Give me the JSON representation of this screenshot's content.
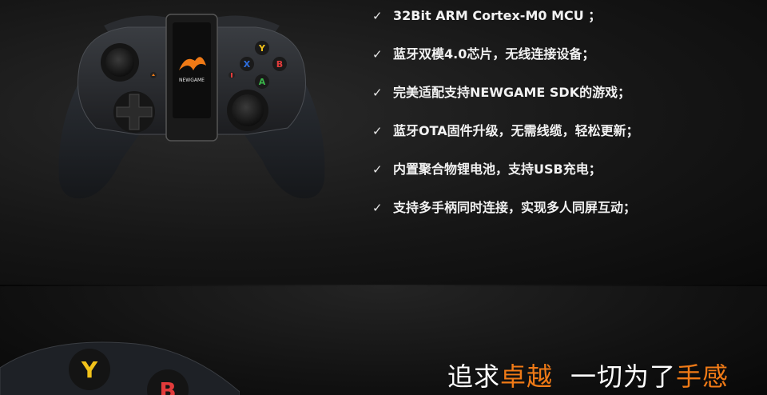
{
  "features": [
    {
      "check": "✓",
      "text": "32Bit ARM Cortex-M0 MCU ；"
    },
    {
      "check": "✓",
      "text": "蓝牙双模4.0芯片，无线连接设备；"
    },
    {
      "check": "✓",
      "text": "完美适配支持NEWGAME SDK的游戏；"
    },
    {
      "check": "✓",
      "text": "蓝牙OTA固件升级，无需线缆，轻松更新；"
    },
    {
      "check": "✓",
      "text": "内置聚合物锂电池，支持USB充电；"
    },
    {
      "check": "✓",
      "text": "支持多手柄同时连接，实现多人同屏互动；"
    }
  ],
  "controller": {
    "brand": "NEWGAME",
    "buttons": {
      "y": "Y",
      "x": "X",
      "b": "B",
      "a": "A"
    }
  },
  "slogan": {
    "part1": "追求",
    "part1_highlight": "卓越",
    "part2": "一切为了",
    "part2_highlight": "手感"
  },
  "bottom_buttons": {
    "y": "Y",
    "b": "B"
  },
  "colors": {
    "accent": "#f07a16",
    "button_y": "#f2c21a",
    "button_x": "#2f6fe0",
    "button_b": "#e23b3b",
    "button_a": "#3ab54a"
  }
}
